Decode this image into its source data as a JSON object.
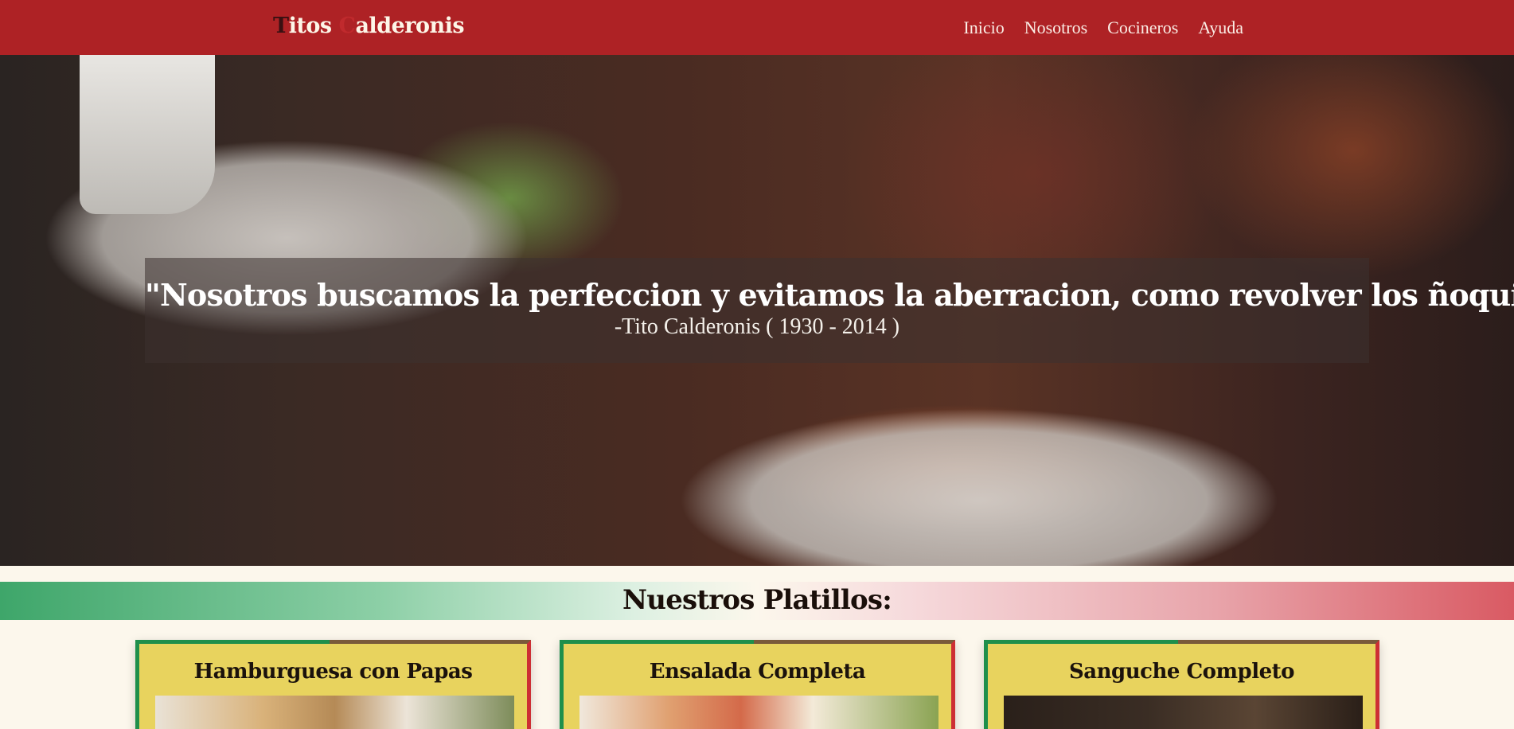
{
  "navbar": {
    "brand_first_initial": "T",
    "brand_first_rest": "itos ",
    "brand_second_initial": "C",
    "brand_second_rest": "alderonis",
    "links": [
      "Inicio",
      "Nosotros",
      "Cocineros",
      "Ayuda"
    ],
    "background_color": "#ae2225"
  },
  "hero": {
    "quote": "\"Nosotros buscamos la perfeccion y evitamos la aberracion, como revolver los ñoquis\"",
    "author": "-Tito Calderonis ( 1930 - 2014 )"
  },
  "section": {
    "title": "Nuestros Platillos:"
  },
  "dishes": [
    {
      "title": "Hamburguesa con Papas"
    },
    {
      "title": "Ensalada Completa"
    },
    {
      "title": "Sanguche Completo"
    }
  ],
  "colors": {
    "accent_red": "#ae2225",
    "accent_green": "#1f8f4b",
    "card_yellow": "#e8d35e",
    "page_background": "#fcf7ec"
  }
}
